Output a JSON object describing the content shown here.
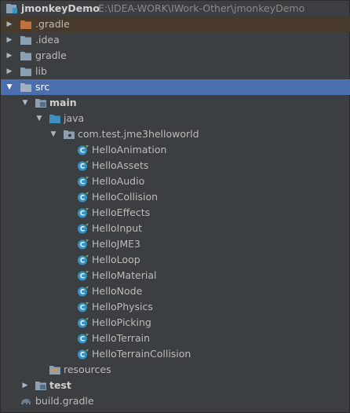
{
  "project": {
    "name": "jmonkeyDemo",
    "path": "E:\\IDEA-WORK\\IWork-Other\\jmonkeyDemo"
  },
  "colors": {
    "background": "#3c3f41",
    "selection": "#4b6eaf",
    "gradle_highlight": "#473a2a",
    "folder": "#8ca0b3",
    "folder_orange": "#c0713f",
    "class_icon": "#3592c4"
  },
  "tree": {
    "gradle_dir": {
      "label": ".gradle",
      "icon": "orange-folder-icon"
    },
    "idea_dir": {
      "label": ".idea",
      "icon": "folder-icon"
    },
    "gradle_folder": {
      "label": "gradle",
      "icon": "folder-icon"
    },
    "lib_folder": {
      "label": "lib",
      "icon": "folder-icon"
    },
    "src_folder": {
      "label": "src",
      "icon": "folder-icon"
    },
    "main_folder": {
      "label": "main",
      "icon": "source-folder-icon"
    },
    "java_folder": {
      "label": "java",
      "icon": "source-root-icon"
    },
    "package": {
      "label": "com.test.jme3helloworld",
      "icon": "package-icon"
    },
    "classes": [
      "HelloAnimation",
      "HelloAssets",
      "HelloAudio",
      "HelloCollision",
      "HelloEffects",
      "HelloInput",
      "HelloJME3",
      "HelloLoop",
      "HelloMaterial",
      "HelloNode",
      "HelloPhysics",
      "HelloPicking",
      "HelloTerrain",
      "HelloTerrainCollision"
    ],
    "resources_folder": {
      "label": "resources",
      "icon": "resources-folder-icon"
    },
    "test_folder": {
      "label": "test",
      "icon": "source-folder-icon"
    },
    "build_file": {
      "label": "build.gradle",
      "icon": "gradle-elephant-icon"
    }
  }
}
